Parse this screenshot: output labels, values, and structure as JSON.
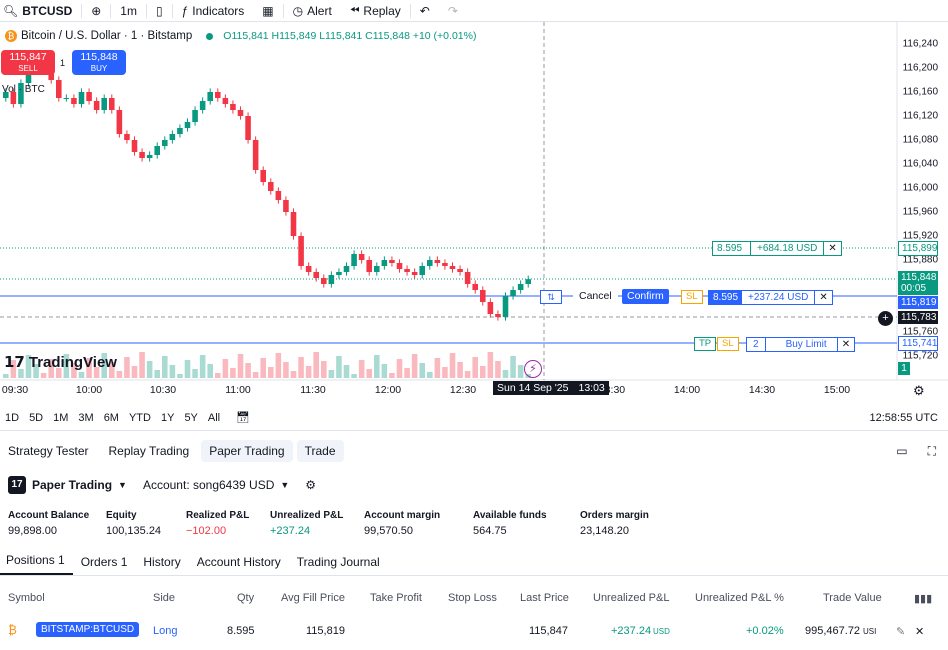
{
  "toolbar": {
    "symbol": "BTCUSD",
    "interval": "1m",
    "indicators_label": "Indicators",
    "alert_label": "Alert",
    "replay_label": "Replay"
  },
  "legend": {
    "title": "Bitcoin / U.S. Dollar · 1 · Bitstamp",
    "ohlc": "O115,841 H115,849 L115,841 C115,848 +10 (+0.01%)",
    "volume": "Vol · BTC"
  },
  "trade_buttons": {
    "sell_price": "115,847",
    "sell_label": "SELL",
    "buy_price": "115,848",
    "buy_label": "BUY",
    "spread": "1"
  },
  "chart_data": {
    "type": "candlestick",
    "y_ticks": [
      "116,240",
      "116,200",
      "116,160",
      "116,120",
      "116,080",
      "116,040",
      "116,000",
      "115,960",
      "115,920",
      "115,880",
      "115,760",
      "115,720"
    ],
    "ylim": [
      115700,
      116250
    ],
    "x_ticks": [
      "09:30",
      "10:00",
      "10:30",
      "11:00",
      "11:30",
      "12:00",
      "12:30",
      "13:30",
      "14:00",
      "14:30",
      "15:00"
    ],
    "close_series": [
      116160,
      116140,
      116175,
      116195,
      116210,
      116200,
      116180,
      116150,
      116150,
      116140,
      116160,
      116145,
      116130,
      116150,
      116130,
      116090,
      116080,
      116060,
      116050,
      116055,
      116070,
      116080,
      116090,
      116100,
      116110,
      116130,
      116145,
      116160,
      116150,
      116140,
      116130,
      116120,
      116080,
      116030,
      116010,
      115995,
      115980,
      115960,
      115920,
      115870,
      115860,
      115850,
      115840,
      115855,
      115860,
      115870,
      115890,
      115880,
      115860,
      115870,
      115880,
      115875,
      115865,
      115860,
      115855,
      115870,
      115880,
      115875,
      115870,
      115865,
      115860,
      115840,
      115830,
      115810,
      115790,
      115785,
      115820,
      115830,
      115840,
      115848
    ]
  },
  "price_axis_labels": {
    "line1": "115,899",
    "current_price": "115,848",
    "countdown": "00:05",
    "position_line": "115,819",
    "crosshair": "115,783",
    "limit_line": "115,741"
  },
  "chart_orders": {
    "tp_line": {
      "qty": "8.595",
      "pnl": "+684.18 USD"
    },
    "position": {
      "cancel_label": "Cancel",
      "confirm_label": "Confirm",
      "sl_label": "SL",
      "qty": "8.595",
      "pnl": "+237.24 USD"
    },
    "limit": {
      "tp_label": "TP",
      "sl_label": "SL",
      "qty": "2",
      "type": "Buy Limit"
    }
  },
  "crosshair_time": "Sun 14 Sep '25",
  "crosshair_clock": "13:03",
  "brand": "TradingView",
  "counter_badge": "1",
  "date_ranges": [
    "1D",
    "5D",
    "1M",
    "3M",
    "6M",
    "YTD",
    "1Y",
    "5Y",
    "All"
  ],
  "clock": "12:58:55 UTC",
  "bottom_tabs": [
    "Strategy Tester",
    "Replay Trading",
    "Paper Trading",
    "Trade"
  ],
  "account": {
    "broker": "Paper Trading",
    "account_label": "Account: song6439 USD",
    "stats": [
      {
        "label": "Account Balance",
        "value": "99,898.00"
      },
      {
        "label": "Equity",
        "value": "100,135.24"
      },
      {
        "label": "Realized P&L",
        "value": "−102.00"
      },
      {
        "label": "Unrealized P&L",
        "value": "+237.24"
      },
      {
        "label": "Account margin",
        "value": "99,570.50"
      },
      {
        "label": "Available funds",
        "value": "564.75"
      },
      {
        "label": "Orders margin",
        "value": "23,148.20"
      }
    ]
  },
  "position_tabs": [
    "Positions 1",
    "Orders 1",
    "History",
    "Account History",
    "Trading Journal"
  ],
  "table": {
    "headers": [
      "Symbol",
      "Side",
      "Qty",
      "Avg Fill Price",
      "Take Profit",
      "Stop Loss",
      "Last Price",
      "Unrealized P&L",
      "Unrealized P&L %",
      "Trade Value"
    ],
    "row": {
      "symbol": "BITSTAMP:BTCUSD",
      "side": "Long",
      "qty": "8.595",
      "avg_fill": "115,819",
      "take_profit": "",
      "stop_loss": "",
      "last_price": "115,847",
      "unrealized_pnl": "+237.24",
      "unrealized_pnl_unit": "USD",
      "unrealized_pct": "+0.02%",
      "trade_value": "995,467.72",
      "trade_value_unit": "USI"
    }
  },
  "colors": {
    "up": "#089981",
    "down": "#f23645",
    "accent": "#2962ff"
  }
}
